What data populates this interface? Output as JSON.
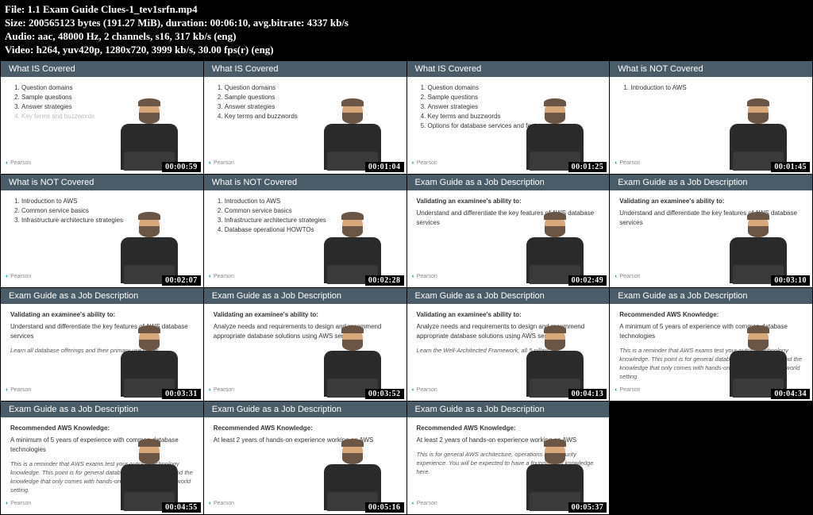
{
  "header": {
    "file_label": "File:",
    "file_value": "1.1 Exam Guide Clues-1_tev1srfn.mp4",
    "size_label": "Size:",
    "size_bytes": "200565123",
    "size_unit": "bytes",
    "size_mib": "(191.27 MiB)",
    "duration_label": "duration:",
    "duration_value": "00:06:10",
    "bitrate_label": "avg.bitrate:",
    "bitrate_value": "4337 kb/s",
    "audio_label": "Audio:",
    "audio_value": "aac, 48000 Hz, 2 channels, s16, 317 kb/s (eng)",
    "video_label": "Video:",
    "video_value": "h264, yuv420p, 1280x720, 3999 kb/s, 30.00 fps(r) (eng)"
  },
  "pearson_label": "Pearson",
  "thumbs": [
    {
      "title": "What IS Covered",
      "ts": "00:00:59",
      "items": [
        "Question domains",
        "Sample questions",
        "Answer strategies"
      ],
      "grey": "Key terms and buzzwords"
    },
    {
      "title": "What IS Covered",
      "ts": "00:01:04",
      "items": [
        "Question domains",
        "Sample questions",
        "Answer strategies",
        "Key terms and buzzwords"
      ]
    },
    {
      "title": "What IS Covered",
      "ts": "00:01:25",
      "items": [
        "Question domains",
        "Sample questions",
        "Answer strategies",
        "Key terms and buzzwords",
        "Options for database services and features"
      ]
    },
    {
      "title": "What is NOT Covered",
      "ts": "00:01:45",
      "items": [
        "Introduction to AWS"
      ]
    },
    {
      "title": "What is NOT Covered",
      "ts": "00:02:07",
      "items": [
        "Introduction to AWS",
        "Common service basics",
        "Infrastructure architecture strategies"
      ]
    },
    {
      "title": "What is NOT Covered",
      "ts": "00:02:28",
      "items": [
        "Introduction to AWS",
        "Common service basics",
        "Infrastructure architecture strategies",
        "Database operational HOWTOs"
      ]
    },
    {
      "title": "Exam Guide as a Job Description",
      "ts": "00:02:49",
      "bold": "Validating an examinee's ability to:",
      "body": "Understand and differentiate the key features of AWS database services"
    },
    {
      "title": "Exam Guide as a Job Description",
      "ts": "00:03:10",
      "bold": "Validating an examinee's ability to:",
      "body": "Understand and differentiate the key features of AWS database services"
    },
    {
      "title": "Exam Guide as a Job Description",
      "ts": "00:03:31",
      "bold": "Validating an examinee's ability to:",
      "body": "Understand and differentiate the key features of AWS database services",
      "italic": "Learn all database offerings and their primary use cases."
    },
    {
      "title": "Exam Guide as a Job Description",
      "ts": "00:03:52",
      "bold": "Validating an examinee's ability to:",
      "body": "Analyze needs and requirements to design and recommend appropriate database solutions using AWS services"
    },
    {
      "title": "Exam Guide as a Job Description",
      "ts": "00:04:13",
      "bold": "Validating an examinee's ability to:",
      "body": "Analyze needs and requirements to design and recommend appropriate database solutions using AWS services",
      "italic": "Learn the Well-Architected Framework, all 5 pillars."
    },
    {
      "title": "Exam Guide as a Job Description",
      "ts": "00:04:34",
      "bold": "Recommended AWS Knowledge:",
      "body": "A minimum of 5 years of experience with common database technologies",
      "italic": "This is a reminder that AWS exams test your outside technology knowledge. This point is for general database understanding, and the knowledge that only comes with hands-on experience in a real-world setting."
    },
    {
      "title": "Exam Guide as a Job Description",
      "ts": "00:04:55",
      "bold": "Recommended AWS Knowledge:",
      "body": "A minimum of 5 years of experience with common database technologies",
      "italic": "This is a reminder that AWS exams test your outside technology knowledge. This point is for general database understanding, and the knowledge that only comes with hands-on experience in a real-world setting."
    },
    {
      "title": "Exam Guide as a Job Description",
      "ts": "00:05:16",
      "bold": "Recommended AWS Knowledge:",
      "body": "At least 2 years of hands-on experience working on AWS"
    },
    {
      "title": "Exam Guide as a Job Description",
      "ts": "00:05:37",
      "bold": "Recommended AWS Knowledge:",
      "body": "At least 2 years of hands-on experience working on AWS",
      "italic": "This is for general AWS architecture, operations and security experience. You will be expected to have a foundational knowledge here."
    }
  ]
}
